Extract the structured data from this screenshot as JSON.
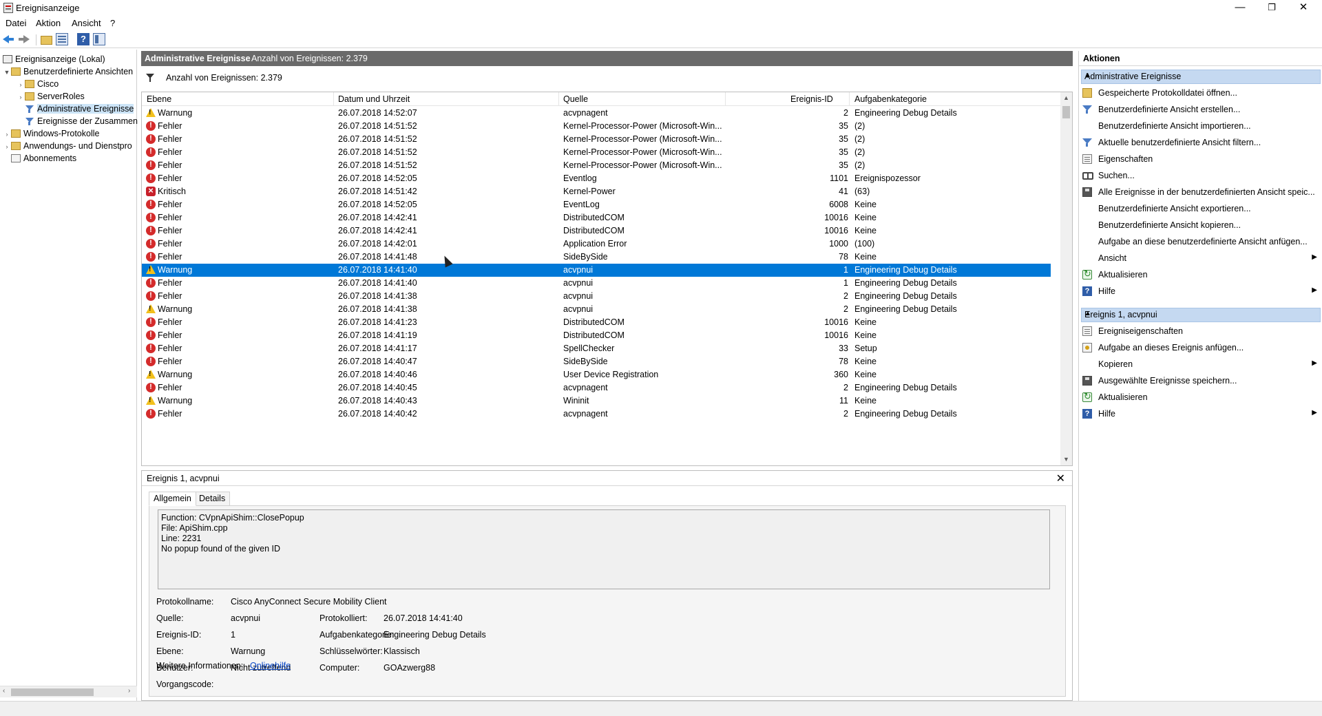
{
  "window": {
    "title": "Ereignisanzeige",
    "minimize": "—",
    "restore": "❐",
    "close": "✕"
  },
  "menu": [
    "Datei",
    "Aktion",
    "Ansicht",
    "?"
  ],
  "tree": {
    "root": "Ereignisanzeige (Lokal)",
    "custom_views": "Benutzerdefinierte Ansichten",
    "cisco": "Cisco",
    "server_roles": "ServerRoles",
    "admin_events": "Administrative Ereignisse",
    "summary_events": "Ereignisse der Zusammen",
    "windows_logs": "Windows-Protokolle",
    "app_logs": "Anwendungs- und Dienstpro",
    "subscriptions": "Abonnements"
  },
  "center": {
    "header_title": "Administrative Ereignisse",
    "header_count": "Anzahl von Ereignissen: 2.379",
    "filter_text": "Anzahl von Ereignissen: 2.379",
    "columns": [
      "Ebene",
      "Datum und Uhrzeit",
      "Quelle",
      "Ereignis-ID",
      "Aufgabenkategorie"
    ],
    "rows": [
      {
        "level": "Warnung",
        "icon": "warning-icon",
        "date": "26.07.2018 14:52:07",
        "source": "acvpnagent",
        "id": "2",
        "category": "Engineering Debug Details"
      },
      {
        "level": "Fehler",
        "icon": "error-icon",
        "date": "26.07.2018 14:51:52",
        "source": "Kernel-Processor-Power (Microsoft-Win...",
        "id": "35",
        "category": "(2)"
      },
      {
        "level": "Fehler",
        "icon": "error-icon",
        "date": "26.07.2018 14:51:52",
        "source": "Kernel-Processor-Power (Microsoft-Win...",
        "id": "35",
        "category": "(2)"
      },
      {
        "level": "Fehler",
        "icon": "error-icon",
        "date": "26.07.2018 14:51:52",
        "source": "Kernel-Processor-Power (Microsoft-Win...",
        "id": "35",
        "category": "(2)"
      },
      {
        "level": "Fehler",
        "icon": "error-icon",
        "date": "26.07.2018 14:51:52",
        "source": "Kernel-Processor-Power (Microsoft-Win...",
        "id": "35",
        "category": "(2)"
      },
      {
        "level": "Fehler",
        "icon": "error-icon",
        "date": "26.07.2018 14:52:05",
        "source": "Eventlog",
        "id": "1101",
        "category": "Ereignispozessor"
      },
      {
        "level": "Kritisch",
        "icon": "critical-icon",
        "date": "26.07.2018 14:51:42",
        "source": "Kernel-Power",
        "id": "41",
        "category": "(63)"
      },
      {
        "level": "Fehler",
        "icon": "error-icon",
        "date": "26.07.2018 14:52:05",
        "source": "EventLog",
        "id": "6008",
        "category": "Keine"
      },
      {
        "level": "Fehler",
        "icon": "error-icon",
        "date": "26.07.2018 14:42:41",
        "source": "DistributedCOM",
        "id": "10016",
        "category": "Keine"
      },
      {
        "level": "Fehler",
        "icon": "error-icon",
        "date": "26.07.2018 14:42:41",
        "source": "DistributedCOM",
        "id": "10016",
        "category": "Keine"
      },
      {
        "level": "Fehler",
        "icon": "error-icon",
        "date": "26.07.2018 14:42:01",
        "source": "Application Error",
        "id": "1000",
        "category": "(100)"
      },
      {
        "level": "Fehler",
        "icon": "error-icon",
        "date": "26.07.2018 14:41:48",
        "source": "SideBySide",
        "id": "78",
        "category": "Keine"
      },
      {
        "level": "Warnung",
        "icon": "warning-icon",
        "date": "26.07.2018 14:41:40",
        "source": "acvpnui",
        "id": "1",
        "category": "Engineering Debug Details",
        "selected": true
      },
      {
        "level": "Fehler",
        "icon": "error-icon",
        "date": "26.07.2018 14:41:40",
        "source": "acvpnui",
        "id": "1",
        "category": "Engineering Debug Details"
      },
      {
        "level": "Fehler",
        "icon": "error-icon",
        "date": "26.07.2018 14:41:38",
        "source": "acvpnui",
        "id": "2",
        "category": "Engineering Debug Details"
      },
      {
        "level": "Warnung",
        "icon": "warning-icon",
        "date": "26.07.2018 14:41:38",
        "source": "acvpnui",
        "id": "2",
        "category": "Engineering Debug Details"
      },
      {
        "level": "Fehler",
        "icon": "error-icon",
        "date": "26.07.2018 14:41:23",
        "source": "DistributedCOM",
        "id": "10016",
        "category": "Keine"
      },
      {
        "level": "Fehler",
        "icon": "error-icon",
        "date": "26.07.2018 14:41:19",
        "source": "DistributedCOM",
        "id": "10016",
        "category": "Keine"
      },
      {
        "level": "Fehler",
        "icon": "error-icon",
        "date": "26.07.2018 14:41:17",
        "source": "SpellChecker",
        "id": "33",
        "category": "Setup"
      },
      {
        "level": "Fehler",
        "icon": "error-icon",
        "date": "26.07.2018 14:40:47",
        "source": "SideBySide",
        "id": "78",
        "category": "Keine"
      },
      {
        "level": "Warnung",
        "icon": "warning-icon",
        "date": "26.07.2018 14:40:46",
        "source": "User Device Registration",
        "id": "360",
        "category": "Keine"
      },
      {
        "level": "Fehler",
        "icon": "error-icon",
        "date": "26.07.2018 14:40:45",
        "source": "acvpnagent",
        "id": "2",
        "category": "Engineering Debug Details"
      },
      {
        "level": "Warnung",
        "icon": "warning-icon",
        "date": "26.07.2018 14:40:43",
        "source": "Wininit",
        "id": "11",
        "category": "Keine"
      },
      {
        "level": "Fehler",
        "icon": "error-icon",
        "date": "26.07.2018 14:40:42",
        "source": "acvpnagent",
        "id": "2",
        "category": "Engineering Debug Details"
      }
    ]
  },
  "detail": {
    "title": "Ereignis 1, acvpnui",
    "close": "✕",
    "tabs": [
      "Allgemein",
      "Details"
    ],
    "message": "Function: CVpnApiShim::ClosePopup\nFile: ApiShim.cpp\nLine: 2231\nNo popup found of the given ID",
    "fields": {
      "log_name_label": "Protokollname:",
      "log_name": "Cisco AnyConnect Secure Mobility Client",
      "source_label": "Quelle:",
      "source": "acvpnui",
      "logged_label": "Protokolliert:",
      "logged": "26.07.2018 14:41:40",
      "event_id_label": "Ereignis-ID:",
      "event_id": "1",
      "task_label": "Aufgabenkategorie:",
      "task": "Engineering Debug Details",
      "level_label": "Ebene:",
      "level": "Warnung",
      "keywords_label": "Schlüsselwörter:",
      "keywords": "Klassisch",
      "user_label": "Benutzer:",
      "user": "Nicht zutreffend",
      "computer_label": "Computer:",
      "computer": "GOAzwerg88",
      "opcode_label": "Vorgangscode:",
      "more_info_label": "Weitere Informationen:",
      "more_info_link": "Onlinehilfe"
    }
  },
  "actions": {
    "title": "Aktionen",
    "section1": "Administrative Ereignisse",
    "items1": [
      {
        "label": "Gespeicherte Protokolldatei öffnen...",
        "icon": "folder-icon"
      },
      {
        "label": "Benutzerdefinierte Ansicht erstellen...",
        "icon": "filter-icon"
      },
      {
        "label": "Benutzerdefinierte Ansicht importieren...",
        "icon": ""
      },
      {
        "label": "Aktuelle benutzerdefinierte Ansicht filtern...",
        "icon": "filter-icon"
      },
      {
        "label": "Eigenschaften",
        "icon": "properties-icon"
      },
      {
        "label": "Suchen...",
        "icon": "binoculars-icon"
      },
      {
        "label": "Alle Ereignisse in der benutzerdefinierten Ansicht speic...",
        "icon": "save-icon"
      },
      {
        "label": "Benutzerdefinierte Ansicht exportieren...",
        "icon": ""
      },
      {
        "label": "Benutzerdefinierte Ansicht kopieren...",
        "icon": ""
      },
      {
        "label": "Aufgabe an diese benutzerdefinierte Ansicht anfügen...",
        "icon": ""
      },
      {
        "label": "Ansicht",
        "icon": "",
        "submenu": true
      },
      {
        "label": "Aktualisieren",
        "icon": "refresh-icon"
      },
      {
        "label": "Hilfe",
        "icon": "help-icon",
        "submenu": true
      }
    ],
    "section2": "Ereignis 1, acvpnui",
    "items2": [
      {
        "label": "Ereigniseigenschaften",
        "icon": "properties-icon"
      },
      {
        "label": "Aufgabe an dieses Ereignis anfügen...",
        "icon": "task-icon"
      },
      {
        "label": "Kopieren",
        "icon": "",
        "submenu": true
      },
      {
        "label": "Ausgewählte Ereignisse speichern...",
        "icon": "save-icon"
      },
      {
        "label": "Aktualisieren",
        "icon": "refresh-icon"
      },
      {
        "label": "Hilfe",
        "icon": "help-icon",
        "submenu": true
      }
    ]
  },
  "colors": {
    "selection": "#0078d7",
    "header_bar": "#6a6a6a",
    "action_section": "#c5d9f1",
    "link": "#0645c7"
  }
}
